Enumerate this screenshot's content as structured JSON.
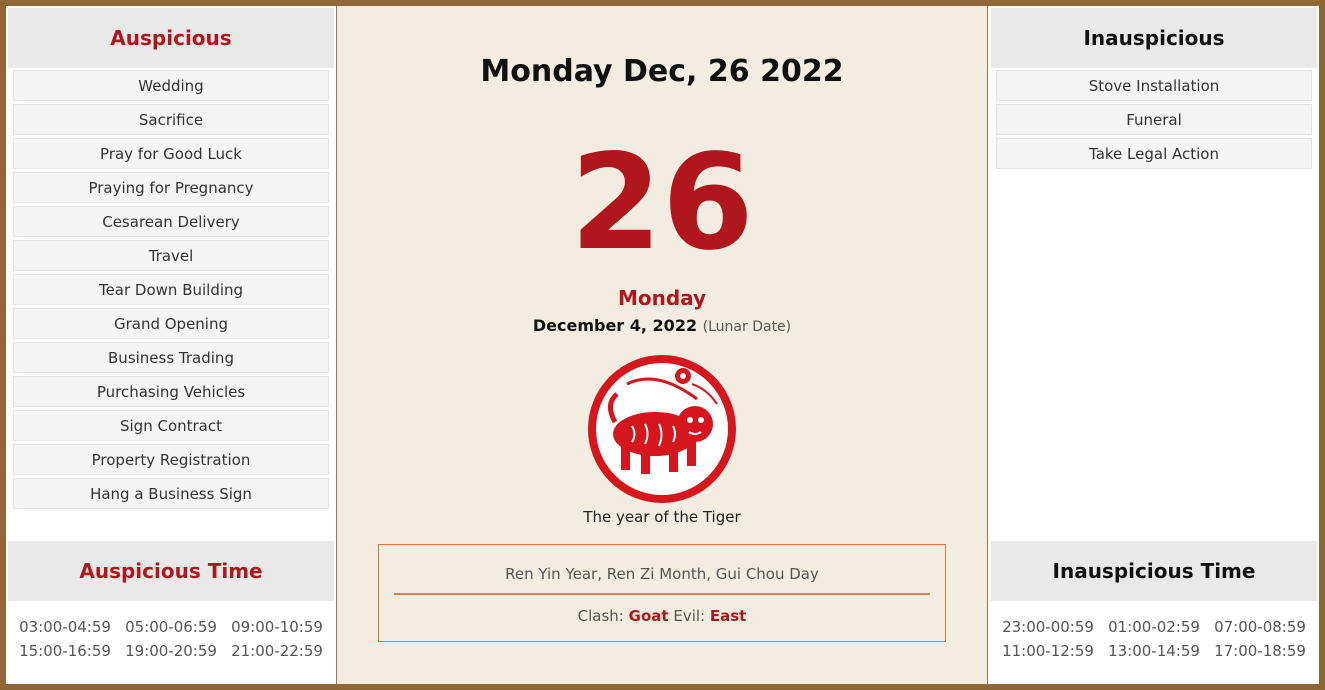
{
  "auspicious": {
    "title": "Auspicious",
    "items": [
      "Wedding",
      "Sacrifice",
      "Pray for Good Luck",
      "Praying for Pregnancy",
      "Cesarean Delivery",
      "Travel",
      "Tear Down Building",
      "Grand Opening",
      "Business Trading",
      "Purchasing Vehicles",
      "Sign Contract",
      "Property Registration",
      "Hang a Business Sign"
    ]
  },
  "auspicious_time": {
    "title": "Auspicious Time",
    "times": [
      "03:00-04:59",
      "05:00-06:59",
      "09:00-10:59",
      "15:00-16:59",
      "19:00-20:59",
      "21:00-22:59"
    ]
  },
  "inauspicious": {
    "title": "Inauspicious",
    "items": [
      "Stove Installation",
      "Funeral",
      "Take Legal Action"
    ]
  },
  "inauspicious_time": {
    "title": "Inauspicious Time",
    "times": [
      "23:00-00:59",
      "01:00-02:59",
      "07:00-08:59",
      "11:00-12:59",
      "13:00-14:59",
      "17:00-18:59"
    ]
  },
  "center": {
    "heading": "Monday Dec, 26 2022",
    "day_number": "26",
    "weekday": "Monday",
    "lunar_date": "December 4, 2022",
    "lunar_note": "(Lunar Date)",
    "zodiac_icon": "tiger-papercut-icon",
    "zodiac_caption": "The year of the Tiger",
    "ganzhi": "Ren Yin Year, Ren Zi Month, Gui Chou Day",
    "clash_label": "Clash:",
    "clash_value": "Goat",
    "evil_label": "Evil:",
    "evil_value": "East"
  },
  "colors": {
    "accent_red": "#b0171c",
    "frame_brown": "#8f6636",
    "box_orange": "#e07a4a"
  }
}
